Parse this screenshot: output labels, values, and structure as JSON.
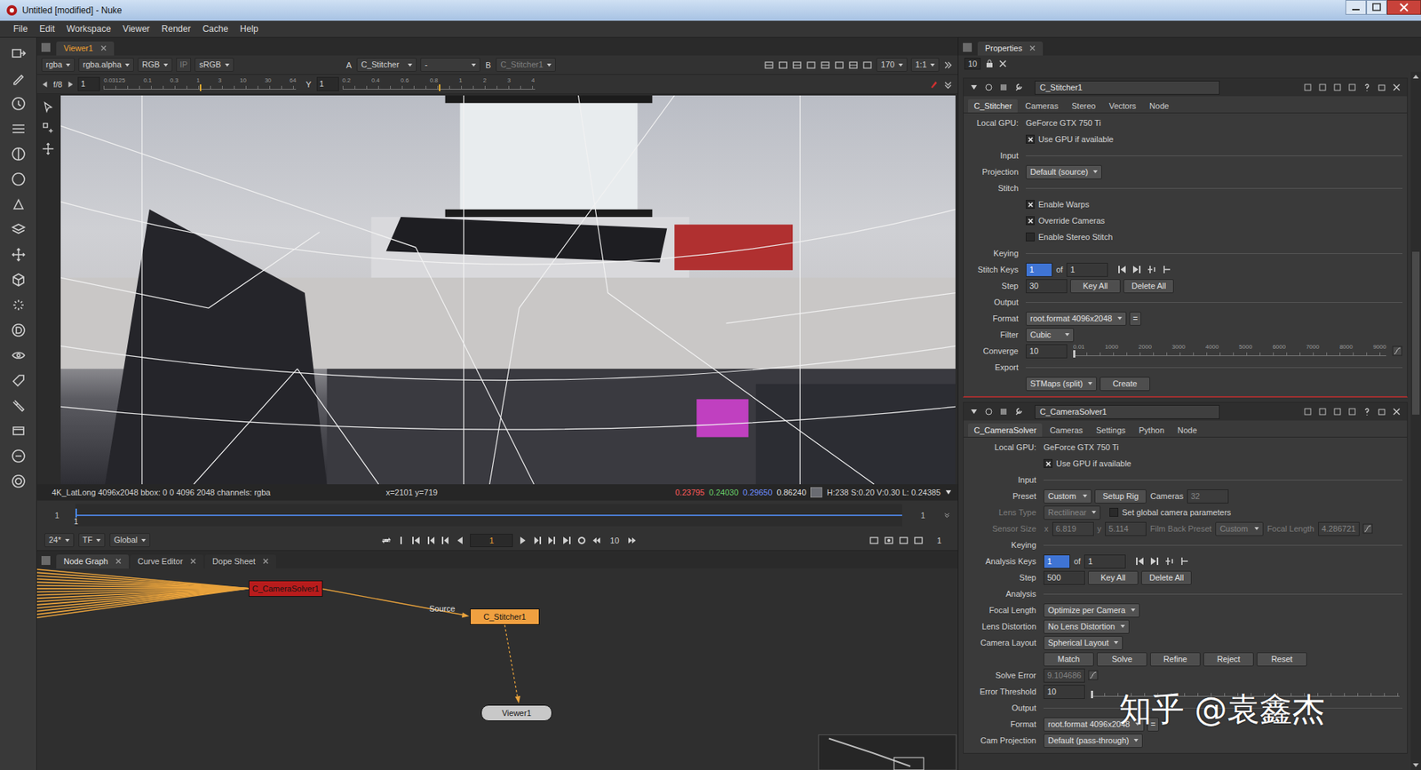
{
  "window": {
    "title": "Untitled [modified] - Nuke"
  },
  "menu": [
    "File",
    "Edit",
    "Workspace",
    "Viewer",
    "Render",
    "Cache",
    "Help"
  ],
  "viewer": {
    "tab": {
      "label": "Viewer1",
      "selected": true
    },
    "channels": [
      {
        "kind": "dropdown",
        "text": "rgba"
      },
      {
        "kind": "dropdown",
        "text": "rgba.alpha"
      },
      {
        "kind": "dropdown",
        "text": "RGB"
      },
      {
        "kind": "button",
        "text": "IP",
        "disabled": true
      },
      {
        "kind": "dropdown",
        "text": "sRGB"
      }
    ],
    "inputs": [
      {
        "kind": "label",
        "text": "A"
      },
      {
        "kind": "dropdown",
        "text": "C_Stitcher"
      },
      {
        "kind": "dropdown",
        "text": "-"
      },
      {
        "kind": "label",
        "text": "B"
      },
      {
        "kind": "dropdown",
        "text": "C_Stitcher1",
        "disabled": true
      }
    ],
    "zoom": [
      {
        "kind": "dropdown",
        "text": "170"
      },
      {
        "kind": "dropdown",
        "text": "1:1"
      }
    ],
    "gain": {
      "label": "f/8",
      "value": "1",
      "level": 0.5,
      "ticks": [
        "0.03125",
        "0.1",
        "0.3",
        "1",
        "3",
        "10",
        "30",
        "64"
      ]
    },
    "gamma": {
      "label": "Y",
      "value": "1",
      "level": 0.5,
      "ticks": [
        "0.2",
        "0.4",
        "0.6",
        "0.8",
        "1",
        "2",
        "3",
        "4"
      ]
    },
    "status": {
      "info": "4K_LatLong 4096x2048 bbox: 0 0 4096 2048 channels: rgba",
      "coords": "x=2101 y=719",
      "values": [
        {
          "text": "0.23795",
          "color": "#ff5a5a"
        },
        {
          "text": "0.24030",
          "color": "#6ad06a"
        },
        {
          "text": "0.29650",
          "color": "#7090ff"
        },
        {
          "text": "0.86240",
          "color": "#e0e0e0"
        }
      ],
      "swatch": "#6a6c72",
      "hsv": "H:238 S:0.20 V:0.30 L: 0.24385"
    },
    "timeline": {
      "start": "1",
      "end": "1",
      "current": "1",
      "level": 0
    },
    "transport": {
      "fps": "24*",
      "mode": "TF",
      "scope": "Global",
      "frame": "1",
      "step": "10",
      "end": "1"
    }
  },
  "nodeGraph": {
    "tabs": [
      {
        "label": "Node Graph",
        "selected": true
      },
      {
        "label": "Curve Editor",
        "selected": false
      },
      {
        "label": "Dope Sheet",
        "selected": false
      }
    ],
    "nodes": [
      {
        "name": "C_CameraSolver1",
        "color": "#b81c1c"
      },
      {
        "name": "C_Stitcher1",
        "color": "#f0a040"
      },
      {
        "name": "Viewer1",
        "color": "#c8c8c8"
      }
    ],
    "inputLabel": "Source"
  },
  "properties": {
    "tab": {
      "label": "Properties",
      "selected": true
    },
    "maxPanels": "10",
    "panels": [
      {
        "name": "C_Stitcher1",
        "tabs": [
          {
            "label": "C_Stitcher",
            "selected": true
          },
          {
            "label": "Cameras",
            "selected": false
          },
          {
            "label": "Stereo",
            "selected": false
          },
          {
            "label": "Vectors",
            "selected": false
          },
          {
            "label": "Node",
            "selected": false
          }
        ],
        "rows": [
          {
            "kind": "info",
            "label": "Local GPU:",
            "value": "GeForce GTX 750 Ti"
          },
          {
            "kind": "checkbox",
            "label": "Use GPU if available",
            "checked": true
          },
          {
            "kind": "section",
            "label": "Input"
          },
          {
            "kind": "controls",
            "label": "Projection",
            "items": [
              {
                "kind": "dropdown",
                "text": "Default (source)"
              }
            ]
          },
          {
            "kind": "section",
            "label": "Stitch"
          },
          {
            "kind": "checkbox",
            "label": "Enable Warps",
            "checked": true
          },
          {
            "kind": "checkbox",
            "label": "Override Cameras",
            "checked": true
          },
          {
            "kind": "checkbox",
            "label": "Enable Stereo Stitch",
            "checked": false
          },
          {
            "kind": "section",
            "label": "Keying"
          },
          {
            "kind": "controls",
            "label": "Stitch Keys",
            "items": [
              {
                "kind": "key",
                "text": "1"
              },
              {
                "kind": "label",
                "text": "of"
              },
              {
                "kind": "input",
                "text": "1"
              },
              {
                "kind": "keynav"
              }
            ]
          },
          {
            "kind": "controls",
            "label": "Step",
            "items": [
              {
                "kind": "input",
                "text": "30"
              },
              {
                "kind": "button",
                "text": "Key All"
              },
              {
                "kind": "button",
                "text": "Delete All"
              }
            ]
          },
          {
            "kind": "section",
            "label": "Output"
          },
          {
            "kind": "controls",
            "label": "Format",
            "items": [
              {
                "kind": "dropdown",
                "text": "root.format 4096x2048"
              },
              {
                "kind": "button",
                "text": "="
              }
            ]
          },
          {
            "kind": "controls",
            "label": "Filter",
            "items": [
              {
                "kind": "dropdown",
                "text": "Cubic"
              }
            ]
          },
          {
            "kind": "controls",
            "label": "Converge",
            "items": [
              {
                "kind": "input",
                "text": "10"
              },
              {
                "kind": "slider",
                "level": 0.001,
                "ticks": [
                  "0.01",
                  "1000",
                  "2000",
                  "3000",
                  "4000",
                  "5000",
                  "6000",
                  "7000",
                  "8000",
                  "9000"
                ]
              },
              {
                "kind": "anim"
              }
            ]
          },
          {
            "kind": "section",
            "label": "Export"
          },
          {
            "kind": "controls",
            "label": "",
            "items": [
              {
                "kind": "dropdown",
                "text": "STMaps (split)"
              },
              {
                "kind": "button",
                "text": "Create"
              }
            ]
          }
        ]
      },
      {
        "name": "C_CameraSolver1",
        "tabs": [
          {
            "label": "C_CameraSolver",
            "selected": true
          },
          {
            "label": "Cameras",
            "selected": false
          },
          {
            "label": "Settings",
            "selected": false
          },
          {
            "label": "Python",
            "selected": false
          },
          {
            "label": "Node",
            "selected": false
          }
        ],
        "rows": [
          {
            "kind": "info",
            "label": "Local GPU:",
            "value": "GeForce GTX 750 Ti"
          },
          {
            "kind": "checkbox",
            "label": "Use GPU if available",
            "checked": true
          },
          {
            "kind": "section",
            "label": "Input"
          },
          {
            "kind": "controls",
            "label": "Preset",
            "items": [
              {
                "kind": "dropdown",
                "text": "Custom"
              },
              {
                "kind": "button",
                "text": "Setup Rig"
              },
              {
                "kind": "label",
                "text": "Cameras"
              },
              {
                "kind": "input",
                "text": "32",
                "disabled": true
              }
            ]
          },
          {
            "kind": "controls",
            "label": "Lens Type",
            "disabled": true,
            "items": [
              {
                "kind": "dropdown",
                "text": "Rectilinear",
                "disabled": true
              },
              {
                "kind": "checkbox",
                "text": "Set global camera parameters",
                "checked": false
              }
            ]
          },
          {
            "kind": "controls",
            "label": "Sensor Size",
            "disabled": true,
            "items": [
              {
                "kind": "label",
                "text": "x",
                "disabled": true
              },
              {
                "kind": "input",
                "text": "6.819",
                "disabled": true
              },
              {
                "kind": "label",
                "text": "y",
                "disabled": true
              },
              {
                "kind": "input",
                "text": "5.114",
                "disabled": true
              },
              {
                "kind": "label",
                "text": "Film Back Preset",
                "disabled": true
              },
              {
                "kind": "dropdown",
                "text": "Custom",
                "disabled": true
              },
              {
                "kind": "label",
                "text": "Focal Length",
                "disabled": true
              },
              {
                "kind": "input",
                "text": "4.286721",
                "disabled": true
              },
              {
                "kind": "anim"
              }
            ]
          },
          {
            "kind": "section",
            "label": "Keying"
          },
          {
            "kind": "controls",
            "label": "Analysis Keys",
            "items": [
              {
                "kind": "key",
                "text": "1"
              },
              {
                "kind": "label",
                "text": "of"
              },
              {
                "kind": "input",
                "text": "1"
              },
              {
                "kind": "keynav"
              }
            ]
          },
          {
            "kind": "controls",
            "label": "Step",
            "items": [
              {
                "kind": "input",
                "text": "500"
              },
              {
                "kind": "button",
                "text": "Key All"
              },
              {
                "kind": "button",
                "text": "Delete All"
              }
            ]
          },
          {
            "kind": "section",
            "label": "Analysis"
          },
          {
            "kind": "controls",
            "label": "Focal Length",
            "items": [
              {
                "kind": "dropdown",
                "text": "Optimize per Camera"
              }
            ]
          },
          {
            "kind": "controls",
            "label": "Lens Distortion",
            "items": [
              {
                "kind": "dropdown",
                "text": "No Lens Distortion"
              }
            ]
          },
          {
            "kind": "controls",
            "label": "Camera Layout",
            "items": [
              {
                "kind": "dropdown",
                "text": "Spherical Layout"
              }
            ]
          },
          {
            "kind": "controls",
            "label": "",
            "items": [
              {
                "kind": "button",
                "text": "Match"
              },
              {
                "kind": "button",
                "text": "Solve"
              },
              {
                "kind": "button",
                "text": "Refine"
              },
              {
                "kind": "button",
                "text": "Reject"
              },
              {
                "kind": "button",
                "text": "Reset"
              }
            ]
          },
          {
            "kind": "controls",
            "label": "Solve Error",
            "items": [
              {
                "kind": "input",
                "text": "9.104686",
                "disabled": true
              },
              {
                "kind": "anim"
              }
            ]
          },
          {
            "kind": "controls",
            "label": "Error Threshold",
            "items": [
              {
                "kind": "input",
                "text": "10"
              },
              {
                "kind": "slider",
                "level": 0,
                "ticks": []
              }
            ]
          },
          {
            "kind": "section",
            "label": "Output"
          },
          {
            "kind": "controls",
            "label": "Format",
            "items": [
              {
                "kind": "dropdown",
                "text": "root.format 4096x2048"
              },
              {
                "kind": "button",
                "text": "="
              }
            ]
          },
          {
            "kind": "controls",
            "label": "Cam Projection",
            "items": [
              {
                "kind": "dropdown",
                "text": "Default (pass-through)"
              }
            ]
          }
        ]
      }
    ]
  },
  "watermark": "知乎 @袁鑫杰"
}
